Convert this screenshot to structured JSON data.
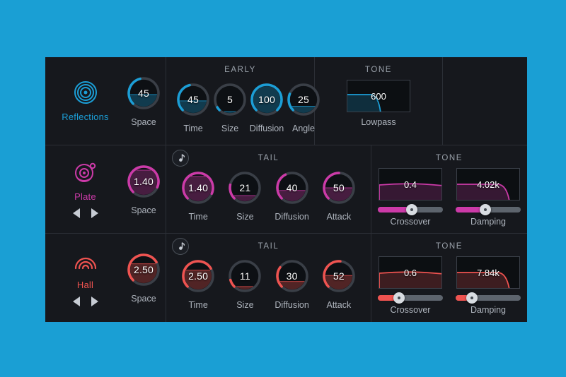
{
  "app": {
    "background_color": "#1a9fd4",
    "panel_color": "#16181d",
    "accent_top_color": "#1b9ed6"
  },
  "rows": [
    {
      "id": "reflections",
      "preset": {
        "name": "Reflections",
        "icon": "concentric-circles-icon",
        "color": "#1b9ed6",
        "has_arrows": false
      },
      "space": {
        "label": "Space",
        "value": "45",
        "pct": 45
      },
      "section": {
        "title": "EARLY",
        "has_sync": false
      },
      "knobs": [
        {
          "label": "Time",
          "value": "45",
          "pct": 45
        },
        {
          "label": "Size",
          "value": "5",
          "pct": 5
        },
        {
          "label": "Diffusion",
          "value": "100",
          "pct": 100
        },
        {
          "label": "Angle",
          "value": "25",
          "pct": 25
        }
      ],
      "tone": {
        "title": "TONE",
        "filters": [
          {
            "label": "Lowpass",
            "value": "600",
            "curve": "lowpass",
            "slider": null
          }
        ]
      }
    },
    {
      "id": "plate",
      "preset": {
        "name": "Plate",
        "icon": "plate-disc-icon",
        "color": "#cc3aa8",
        "has_arrows": true
      },
      "space": {
        "label": "Space",
        "value": "1.40",
        "pct": 92
      },
      "section": {
        "title": "TAIL",
        "has_sync": true,
        "sync_icon": "music-note-icon"
      },
      "knobs": [
        {
          "label": "Time",
          "value": "1.40",
          "pct": 92
        },
        {
          "label": "Size",
          "value": "21",
          "pct": 21
        },
        {
          "label": "Diffusion",
          "value": "40",
          "pct": 40
        },
        {
          "label": "Attack",
          "value": "50",
          "pct": 50
        }
      ],
      "tone": {
        "title": "TONE",
        "filters": [
          {
            "label": "Crossover",
            "value": "0.4",
            "curve": "shelf",
            "slider": 52
          },
          {
            "label": "Damping",
            "value": "4.02k",
            "curve": "damp",
            "slider": 46
          }
        ]
      }
    },
    {
      "id": "hall",
      "preset": {
        "name": "Hall",
        "icon": "hall-arcs-icon",
        "color": "#ef5350",
        "has_arrows": true
      },
      "space": {
        "label": "Space",
        "value": "2.50",
        "pct": 72
      },
      "section": {
        "title": "TAIL",
        "has_sync": true,
        "sync_icon": "music-note-icon"
      },
      "knobs": [
        {
          "label": "Time",
          "value": "2.50",
          "pct": 72
        },
        {
          "label": "Size",
          "value": "11",
          "pct": 11
        },
        {
          "label": "Diffusion",
          "value": "30",
          "pct": 30
        },
        {
          "label": "Attack",
          "value": "52",
          "pct": 52
        }
      ],
      "tone": {
        "title": "TONE",
        "filters": [
          {
            "label": "Crossover",
            "value": "0.6",
            "curve": "shelf",
            "slider": 33
          },
          {
            "label": "Damping",
            "value": "7.84k",
            "curve": "damp",
            "slider": 25
          }
        ]
      }
    }
  ],
  "colors": {
    "reflections": "#1b9ed6",
    "plate": "#cc3aa8",
    "hall": "#ef5350",
    "track": "#5d646d",
    "ring": "#3a3f47",
    "label": "#aeb4bd"
  }
}
